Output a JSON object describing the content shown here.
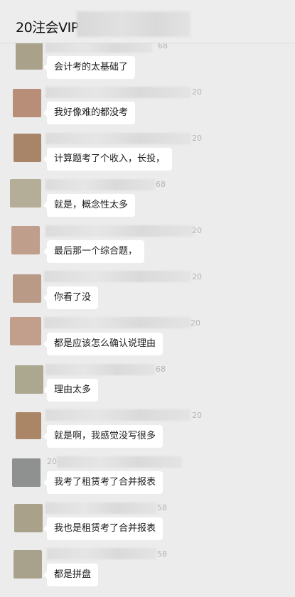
{
  "header": {
    "title": "20注会VIP"
  },
  "messages": [
    {
      "suffix": "68",
      "text": "会计考的太基础了",
      "avatar": "#a9a18a"
    },
    {
      "suffix": "20",
      "text": "我好像难的都没考",
      "avatar": "#b98e78"
    },
    {
      "suffix": "20",
      "text": "计算题考了个收入，长投，",
      "avatar": "#a88568"
    },
    {
      "suffix": "68",
      "text": "就是，概念性太多",
      "avatar": "#b4ae98"
    },
    {
      "suffix": "20",
      "text": "最后那一个综合题，",
      "avatar": "#bf9e8c"
    },
    {
      "suffix": "20",
      "text": "你看了没",
      "avatar": "#b99a86"
    },
    {
      "suffix": "20",
      "text": "都是应该怎么确认说理由",
      "avatar": "#c19f8c"
    },
    {
      "suffix": "68",
      "text": "理由太多",
      "avatar": "#aca78f"
    },
    {
      "suffix": "20",
      "text": "就是啊，我感觉没写很多",
      "avatar": "#aa8666"
    },
    {
      "suffix": "20",
      "text": "我考了租赁考了合并报表",
      "avatar": "#8f9090"
    },
    {
      "suffix": "58",
      "text": "我也是租赁考了合并报表",
      "avatar": "#aaa18b"
    },
    {
      "suffix": "58",
      "text": "都是拼盘",
      "avatar": "#a8a28c"
    }
  ]
}
